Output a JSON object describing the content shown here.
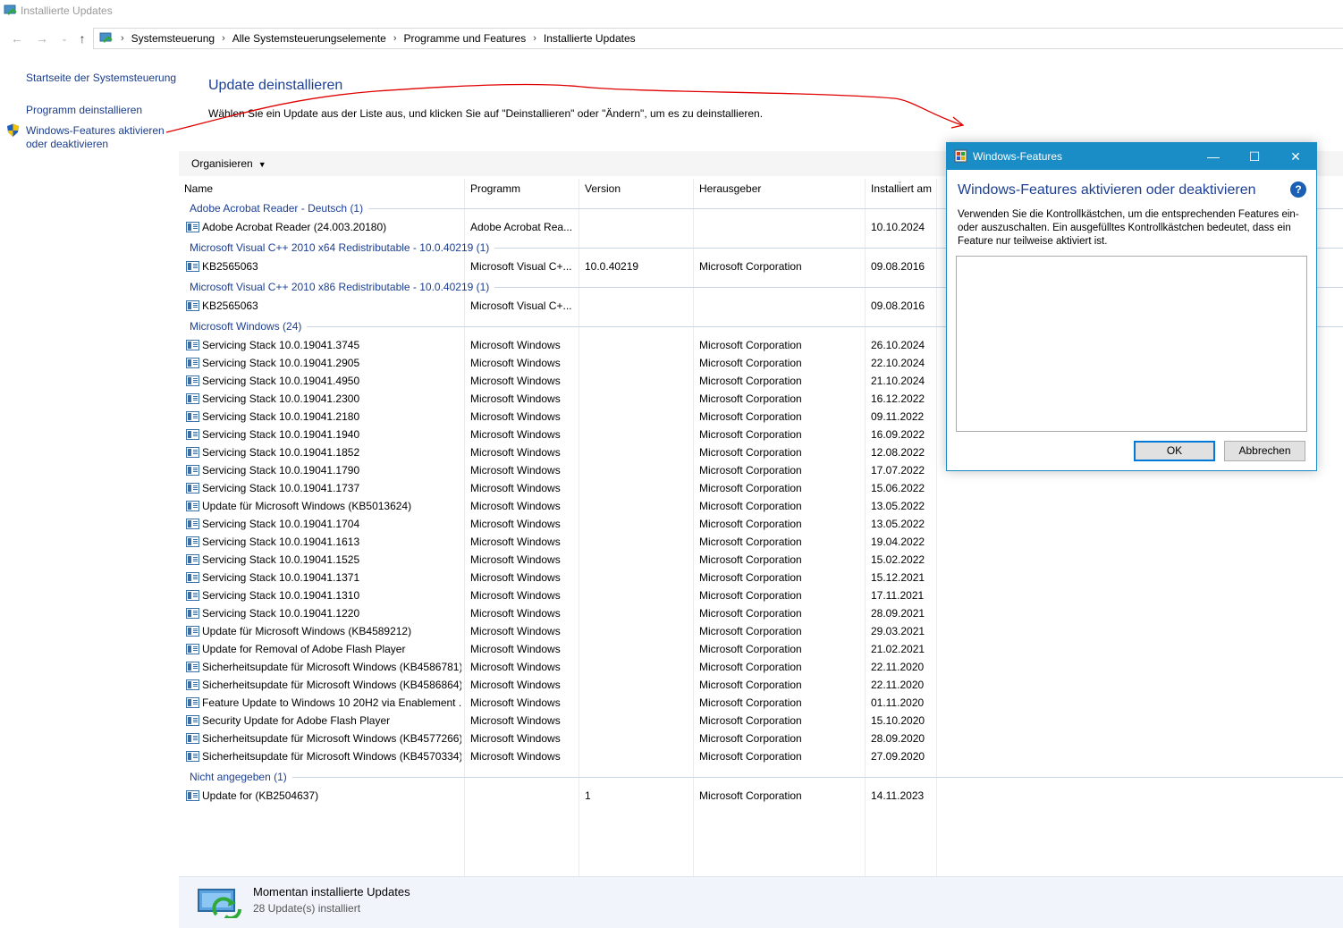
{
  "window": {
    "title": "Installierte Updates"
  },
  "breadcrumbs": [
    "Systemsteuerung",
    "Alle Systemsteuerungselemente",
    "Programme und Features",
    "Installierte Updates"
  ],
  "leftnav": {
    "home": "Startseite der Systemsteuerung",
    "uninstall": "Programm deinstallieren",
    "features_line1": "Windows-Features aktivieren",
    "features_line2": "oder deaktivieren"
  },
  "main": {
    "title": "Update deinstallieren",
    "description": "Wählen Sie ein Update aus der Liste aus, und klicken Sie auf \"Deinstallieren\" oder \"Ändern\", um es zu deinstallieren."
  },
  "toolbar": {
    "organize": "Organisieren"
  },
  "columns": [
    "Name",
    "Programm",
    "Version",
    "Herausgeber",
    "Installiert am"
  ],
  "groups": [
    {
      "label": "Adobe Acrobat Reader - Deutsch (1)",
      "rows": [
        [
          "Adobe Acrobat Reader (24.003.20180)",
          "Adobe Acrobat Rea...",
          "",
          "",
          "10.10.2024"
        ]
      ]
    },
    {
      "label": "Microsoft Visual C++ 2010  x64 Redistributable - 10.0.40219 (1)",
      "rows": [
        [
          "KB2565063",
          "Microsoft Visual C+...",
          "10.0.40219",
          "Microsoft Corporation",
          "09.08.2016"
        ]
      ]
    },
    {
      "label": "Microsoft Visual C++ 2010  x86 Redistributable - 10.0.40219 (1)",
      "rows": [
        [
          "KB2565063",
          "Microsoft Visual C+...",
          "",
          "",
          "09.08.2016"
        ]
      ]
    },
    {
      "label": "Microsoft Windows (24)",
      "rows": [
        [
          "Servicing Stack 10.0.19041.3745",
          "Microsoft Windows",
          "",
          "Microsoft Corporation",
          "26.10.2024"
        ],
        [
          "Servicing Stack 10.0.19041.2905",
          "Microsoft Windows",
          "",
          "Microsoft Corporation",
          "22.10.2024"
        ],
        [
          "Servicing Stack 10.0.19041.4950",
          "Microsoft Windows",
          "",
          "Microsoft Corporation",
          "21.10.2024"
        ],
        [
          "Servicing Stack 10.0.19041.2300",
          "Microsoft Windows",
          "",
          "Microsoft Corporation",
          "16.12.2022"
        ],
        [
          "Servicing Stack 10.0.19041.2180",
          "Microsoft Windows",
          "",
          "Microsoft Corporation",
          "09.11.2022"
        ],
        [
          "Servicing Stack 10.0.19041.1940",
          "Microsoft Windows",
          "",
          "Microsoft Corporation",
          "16.09.2022"
        ],
        [
          "Servicing Stack 10.0.19041.1852",
          "Microsoft Windows",
          "",
          "Microsoft Corporation",
          "12.08.2022"
        ],
        [
          "Servicing Stack 10.0.19041.1790",
          "Microsoft Windows",
          "",
          "Microsoft Corporation",
          "17.07.2022"
        ],
        [
          "Servicing Stack 10.0.19041.1737",
          "Microsoft Windows",
          "",
          "Microsoft Corporation",
          "15.06.2022"
        ],
        [
          "Update für Microsoft Windows (KB5013624)",
          "Microsoft Windows",
          "",
          "Microsoft Corporation",
          "13.05.2022"
        ],
        [
          "Servicing Stack 10.0.19041.1704",
          "Microsoft Windows",
          "",
          "Microsoft Corporation",
          "13.05.2022"
        ],
        [
          "Servicing Stack 10.0.19041.1613",
          "Microsoft Windows",
          "",
          "Microsoft Corporation",
          "19.04.2022"
        ],
        [
          "Servicing Stack 10.0.19041.1525",
          "Microsoft Windows",
          "",
          "Microsoft Corporation",
          "15.02.2022"
        ],
        [
          "Servicing Stack 10.0.19041.1371",
          "Microsoft Windows",
          "",
          "Microsoft Corporation",
          "15.12.2021"
        ],
        [
          "Servicing Stack 10.0.19041.1310",
          "Microsoft Windows",
          "",
          "Microsoft Corporation",
          "17.11.2021"
        ],
        [
          "Servicing Stack 10.0.19041.1220",
          "Microsoft Windows",
          "",
          "Microsoft Corporation",
          "28.09.2021"
        ],
        [
          "Update für Microsoft Windows (KB4589212)",
          "Microsoft Windows",
          "",
          "Microsoft Corporation",
          "29.03.2021"
        ],
        [
          "Update for Removal of Adobe Flash Player",
          "Microsoft Windows",
          "",
          "Microsoft Corporation",
          "21.02.2021"
        ],
        [
          "Sicherheitsupdate für Microsoft Windows (KB4586781)",
          "Microsoft Windows",
          "",
          "Microsoft Corporation",
          "22.11.2020"
        ],
        [
          "Sicherheitsupdate für Microsoft Windows (KB4586864)",
          "Microsoft Windows",
          "",
          "Microsoft Corporation",
          "22.11.2020"
        ],
        [
          "Feature Update to Windows 10 20H2 via Enablement ...",
          "Microsoft Windows",
          "",
          "Microsoft Corporation",
          "01.11.2020"
        ],
        [
          "Security Update for Adobe Flash Player",
          "Microsoft Windows",
          "",
          "Microsoft Corporation",
          "15.10.2020"
        ],
        [
          "Sicherheitsupdate für Microsoft Windows (KB4577266)",
          "Microsoft Windows",
          "",
          "Microsoft Corporation",
          "28.09.2020"
        ],
        [
          "Sicherheitsupdate für Microsoft Windows (KB4570334)",
          "Microsoft Windows",
          "",
          "Microsoft Corporation",
          "27.09.2020"
        ]
      ]
    },
    {
      "label": "Nicht angegeben (1)",
      "rows": [
        [
          "Update for  (KB2504637)",
          "",
          "1",
          "Microsoft Corporation",
          "14.11.2023"
        ]
      ]
    }
  ],
  "status": {
    "title": "Momentan installierte Updates",
    "subtitle": "28 Update(s) installiert"
  },
  "dialog": {
    "title": "Windows-Features",
    "heading": "Windows-Features aktivieren oder deaktivieren",
    "help": "?",
    "desc_line1": "Verwenden Sie die Kontrollkästchen, um die entsprechenden Features ein-",
    "desc_line2": "oder auszuschalten. Ein ausgefülltes Kontrollkästchen bedeutet, dass ein",
    "desc_line3": "Feature nur teilweise aktiviert ist.",
    "ok": "OK",
    "cancel": "Abbrechen",
    "minimize": "—",
    "maximize": "☐",
    "close": "✕"
  },
  "colors": {
    "accent": "#1a8dc6",
    "link": "#1a3c8c",
    "heading": "#1c3f94",
    "annotation": "#e00000"
  }
}
